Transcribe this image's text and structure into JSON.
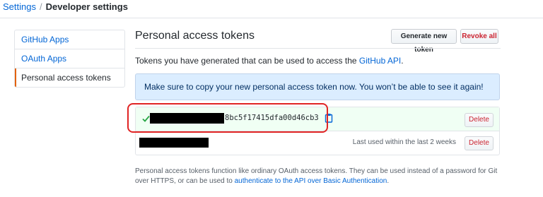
{
  "breadcrumb": {
    "settings": "Settings",
    "separator": "/",
    "current": "Developer settings"
  },
  "sidebar": {
    "items": [
      {
        "label": "GitHub Apps"
      },
      {
        "label": "OAuth Apps"
      },
      {
        "label": "Personal access tokens"
      }
    ]
  },
  "main": {
    "title": "Personal access tokens",
    "generate_label": "Generate new token",
    "revoke_label": "Revoke all",
    "description_prefix": "Tokens you have generated that can be used to access the ",
    "description_link": "GitHub API",
    "description_suffix": ".",
    "flash": "Make sure to copy your new personal access token now. You won’t be able to see it again!"
  },
  "tokens": [
    {
      "visible_suffix": "8bc5f17415dfa00d46cb3",
      "delete_label": "Delete",
      "status_icon": "check-icon",
      "copy_icon": "clipboard-icon"
    },
    {
      "last_used": "Last used within the last 2 weeks",
      "delete_label": "Delete"
    }
  ],
  "footer": {
    "text": "Personal access tokens function like ordinary OAuth access tokens. They can be used instead of a password for Git over HTTPS, or can be used to ",
    "link": "authenticate to the API over Basic Authentication",
    "suffix": "."
  },
  "colors": {
    "link": "#0366d6",
    "selected_accent": "#e36209",
    "danger": "#cb2431",
    "success": "#28a745",
    "flash_bg": "#dbedff",
    "highlight": "#e02424"
  }
}
